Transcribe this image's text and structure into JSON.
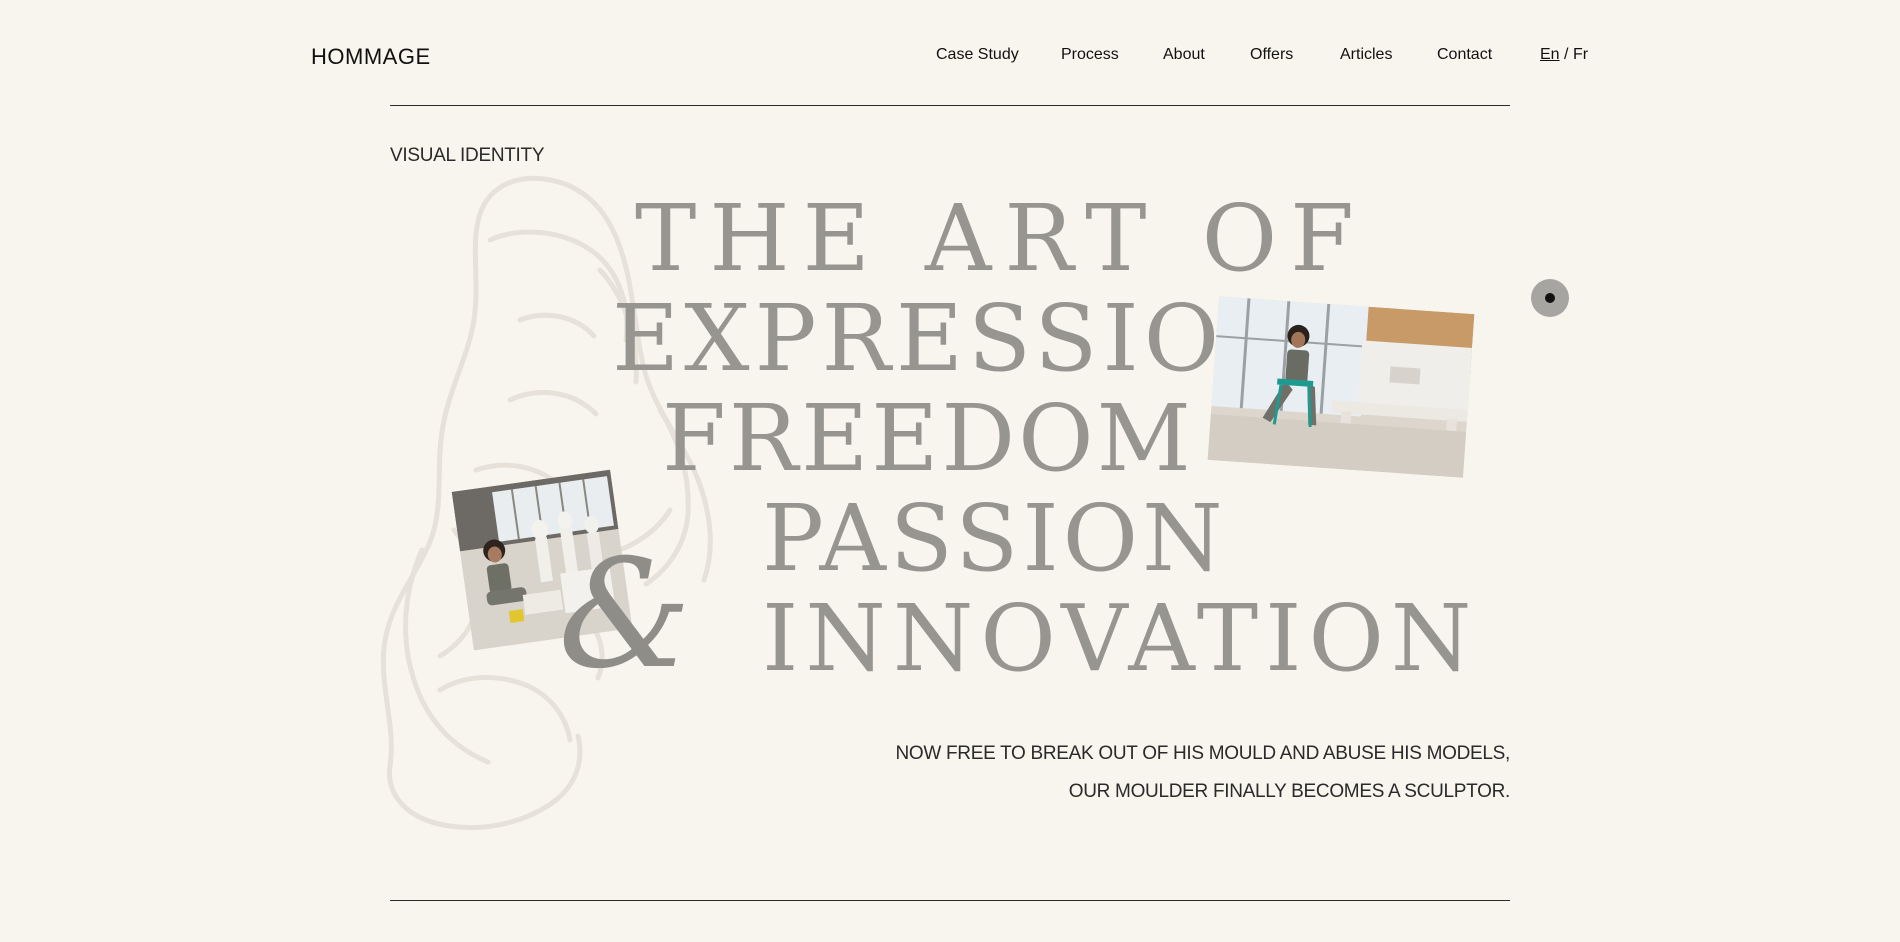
{
  "header": {
    "logo": "HOMMAGE",
    "nav": [
      {
        "label": "Case Study"
      },
      {
        "label": "Process"
      },
      {
        "label": "About"
      },
      {
        "label": "Offers"
      },
      {
        "label": "Articles"
      },
      {
        "label": "Contact"
      }
    ],
    "lang": {
      "active": "En",
      "separator": "/",
      "other": "Fr"
    }
  },
  "hero": {
    "eyebrow": "VISUAL IDENTITY",
    "lines": [
      "THE ART OF",
      "EXPRESSION",
      "FREEDOM",
      "PASSION",
      "INNOVATION"
    ],
    "ampersand": "&",
    "tagline": [
      "NOW FREE TO BREAK OUT OF HIS MOULD AND ABUSE HIS MODELS,",
      "OUR MOULDER FINALLY BECOMES A SCULPTOR."
    ]
  },
  "colors": {
    "background": "#f8f5ef",
    "headline": "#979590",
    "text": "#111111",
    "button": "#a7a5a2"
  },
  "icons": {
    "sketch": "sculpture-head-outline",
    "button": "dot-icon"
  }
}
